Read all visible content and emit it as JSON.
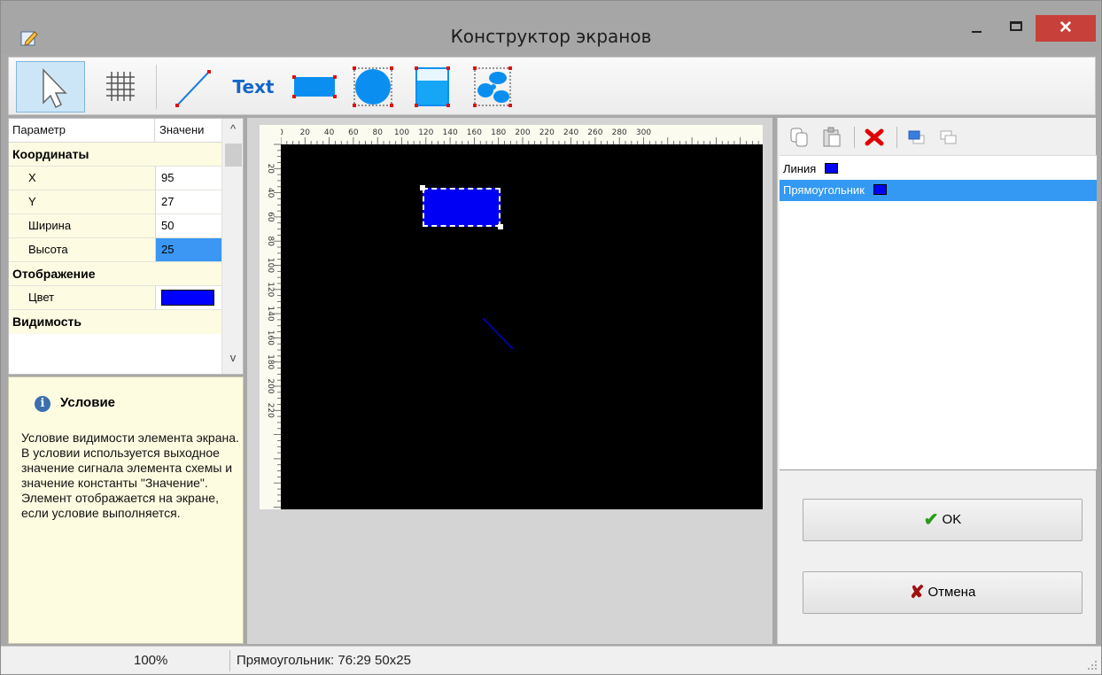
{
  "window": {
    "title": "Конструктор экранов",
    "close_glyph": "✕"
  },
  "toolbar": {
    "tools": [
      "pointer",
      "grid",
      "line",
      "text",
      "rectangle",
      "circle",
      "tank",
      "fan"
    ],
    "text_tool_label": "Text"
  },
  "properties": {
    "headers": {
      "param": "Параметр",
      "value": "Значени"
    },
    "categories": {
      "coords": "Координаты",
      "display": "Отображение",
      "visibility": "Видимость"
    },
    "rows": [
      {
        "name": "X",
        "value": "95"
      },
      {
        "name": "Y",
        "value": "27"
      },
      {
        "name": "Ширина",
        "value": "50"
      },
      {
        "name": "Высота",
        "value": "25"
      }
    ],
    "color_row": {
      "name": "Цвет",
      "value": "#0000ff"
    },
    "scroll_up": "^",
    "scroll_down": "v"
  },
  "description": {
    "icon_glyph": "i",
    "title": "Условие",
    "body": "Условие видимости элемента экрана. В условии используется выходное значение сигнала элемента схемы и значение константы \"Значение\". Элемент отображается на экране, если условие выполняется."
  },
  "canvas": {
    "ruler_x": [
      "0",
      "20",
      "40",
      "60",
      "80",
      "100",
      "120",
      "140",
      "160",
      "180",
      "200",
      "220",
      "240",
      "260",
      "280",
      "300"
    ],
    "ruler_y": [
      "20",
      "40",
      "60",
      "80",
      "100",
      "120",
      "140",
      "160",
      "180",
      "200",
      "220"
    ],
    "background": "#000000",
    "element_color": "#0000ff"
  },
  "objects": {
    "items": [
      {
        "label": "Линия",
        "color": "#0000ff"
      },
      {
        "label": "Прямоугольник",
        "color": "#0000ff"
      }
    ]
  },
  "dialog": {
    "ok_icon": "✔",
    "ok_label": "OK",
    "cancel_icon": "✘",
    "cancel_label": "Отмена"
  },
  "status": {
    "zoom": "100%",
    "selection": "Прямоугольник: 76:29 50x25"
  }
}
